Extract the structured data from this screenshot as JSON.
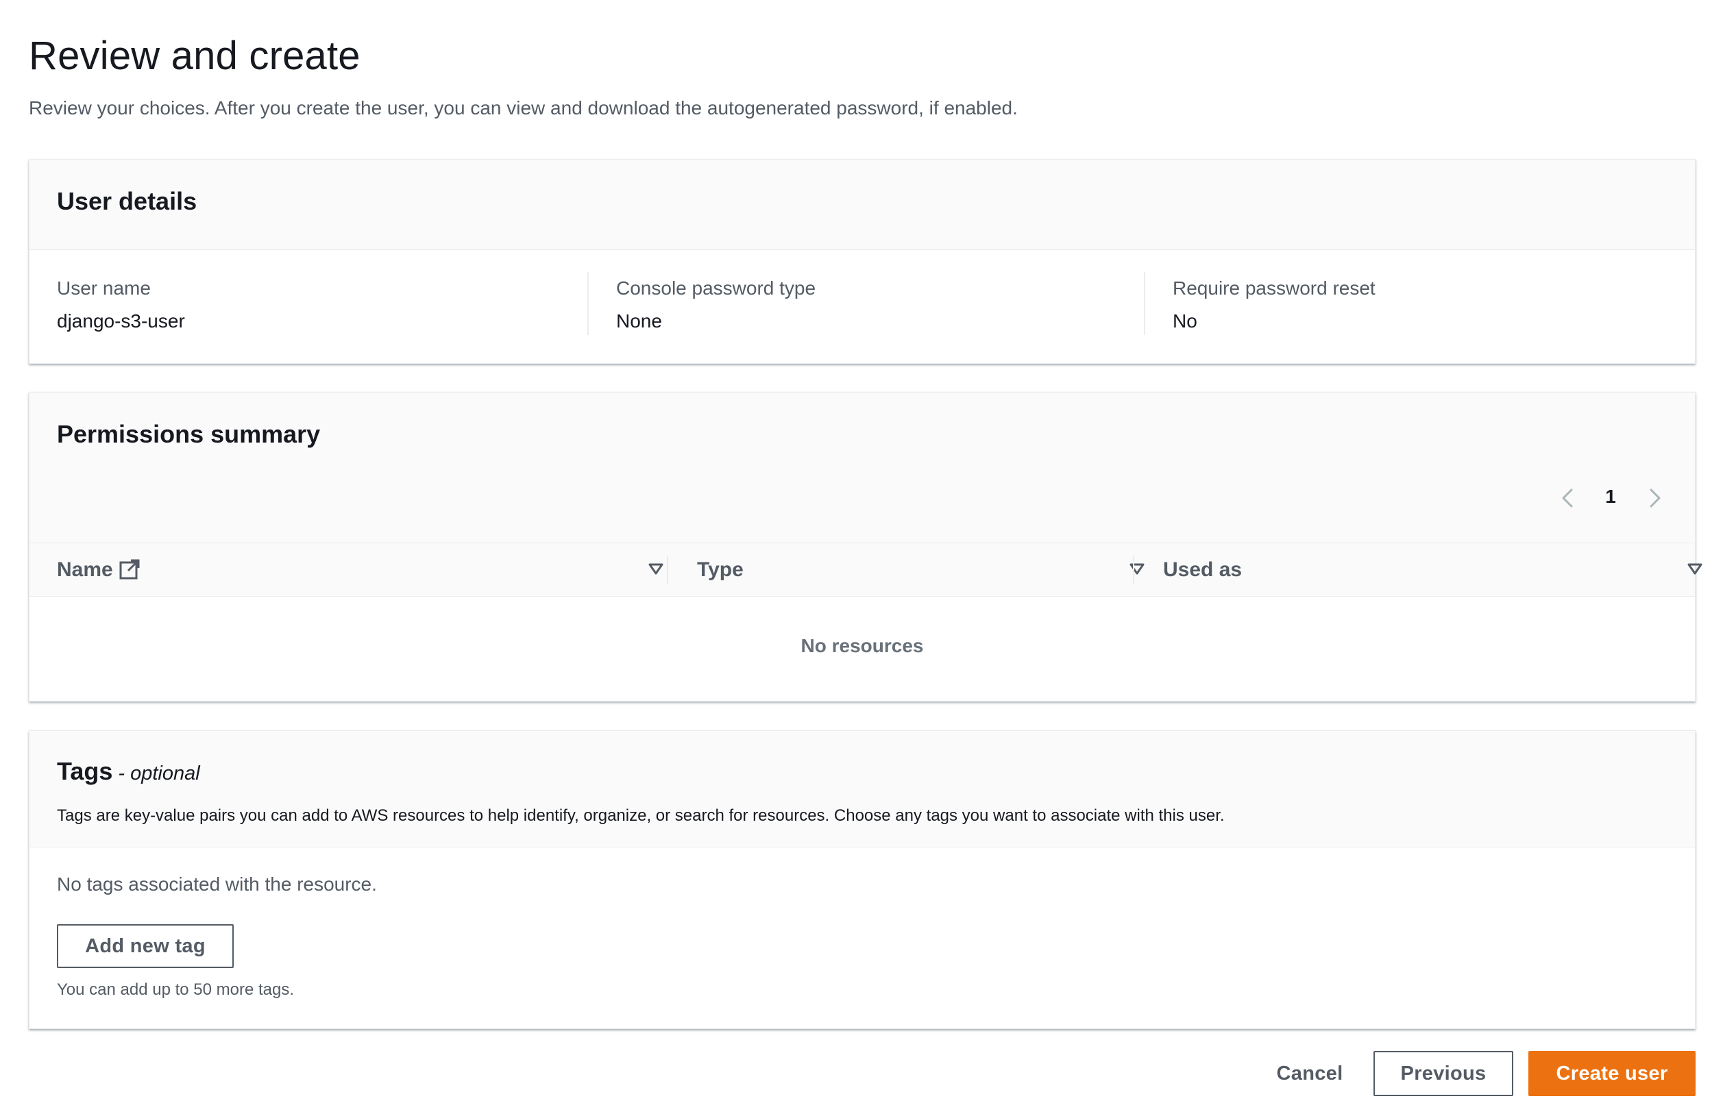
{
  "page": {
    "title": "Review and create",
    "description": "Review your choices. After you create the user, you can view and download the autogenerated password, if enabled."
  },
  "user_details": {
    "title": "User details",
    "fields": [
      {
        "label": "User name",
        "value": "django-s3-user"
      },
      {
        "label": "Console password type",
        "value": "None"
      },
      {
        "label": "Require password reset",
        "value": "No"
      }
    ]
  },
  "permissions": {
    "title": "Permissions summary",
    "pagination": {
      "current_page": "1"
    },
    "columns": [
      "Name",
      "Type",
      "Used as"
    ],
    "empty_text": "No resources"
  },
  "tags": {
    "title": "Tags",
    "optional_suffix": "- optional",
    "description": "Tags are key-value pairs you can add to AWS resources to help identify, organize, or search for resources. Choose any tags you want to associate with this user.",
    "empty_text": "No tags associated with the resource.",
    "add_button": "Add new tag",
    "hint": "You can add up to 50 more tags."
  },
  "footer": {
    "cancel": "Cancel",
    "previous": "Previous",
    "create": "Create user"
  },
  "colors": {
    "primary_button": "#ec7211",
    "text": "#16191f",
    "muted_text": "#545b64",
    "header_bg": "#fafafa",
    "border": "#eaeded"
  }
}
